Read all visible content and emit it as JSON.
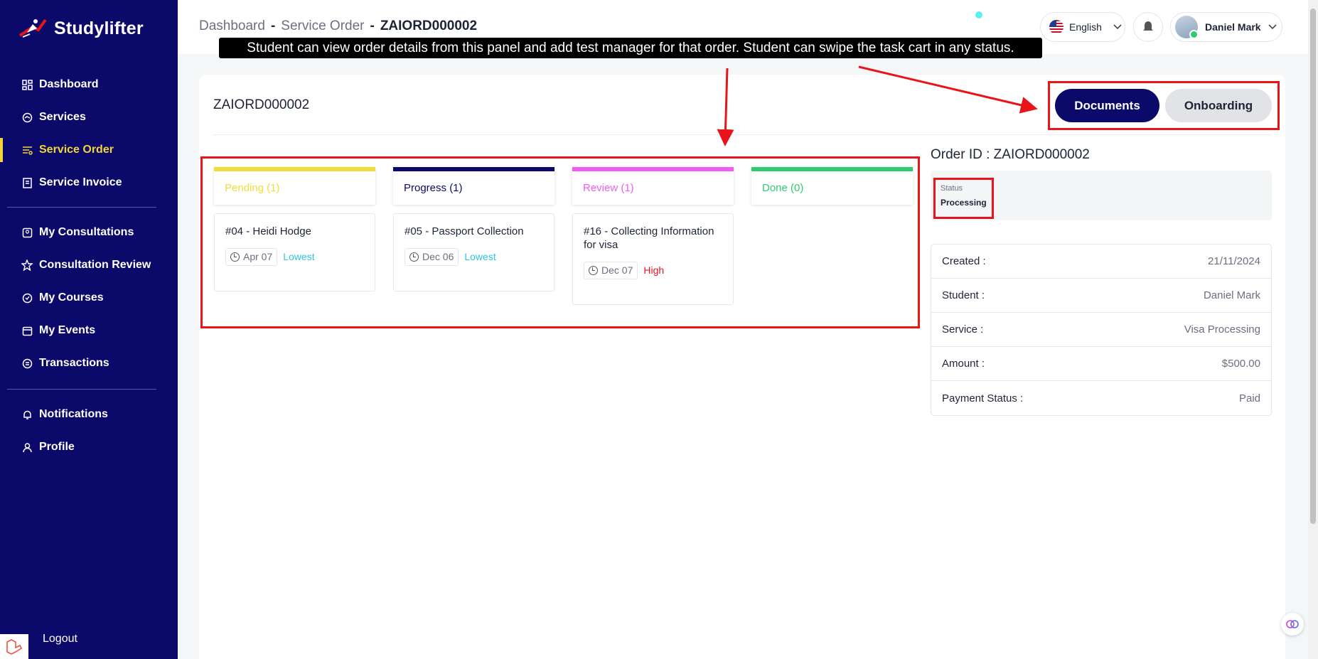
{
  "brand": {
    "name": "Studylifter"
  },
  "sidebar": {
    "group1": [
      {
        "label": "Dashboard",
        "icon": "dashboard-icon",
        "active": false
      },
      {
        "label": "Services",
        "icon": "services-icon",
        "active": false
      },
      {
        "label": "Service Order",
        "icon": "service-order-icon",
        "active": true
      },
      {
        "label": "Service Invoice",
        "icon": "invoice-icon",
        "active": false
      }
    ],
    "group2": [
      {
        "label": "My Consultations",
        "icon": "consultations-icon"
      },
      {
        "label": "Consultation Review",
        "icon": "star-icon"
      },
      {
        "label": "My Courses",
        "icon": "courses-icon"
      },
      {
        "label": "My Events",
        "icon": "calendar-icon"
      },
      {
        "label": "Transactions",
        "icon": "transactions-icon"
      }
    ],
    "group3": [
      {
        "label": "Notifications",
        "icon": "bell-icon"
      },
      {
        "label": "Profile",
        "icon": "user-icon"
      }
    ],
    "logout": "Logout",
    "active_color": "#f4d43c",
    "bg_color": "#0b0a6b"
  },
  "header": {
    "breadcrumb": [
      "Dashboard",
      "Service Order",
      "ZAIORD000002"
    ],
    "separator": "-",
    "language": "English",
    "user_name": "Daniel Mark"
  },
  "banner": {
    "text": "Student can view order details from this panel and add test manager for that order. Student can swipe the task cart in any status."
  },
  "order": {
    "title": "ZAIORD000002",
    "buttons": {
      "documents": "Documents",
      "onboarding": "Onboarding"
    }
  },
  "kanban": {
    "columns": [
      {
        "label": "Pending (1)",
        "color": "#f0dc3c"
      },
      {
        "label": "Progress (1)",
        "color": "#0b0a6b"
      },
      {
        "label": "Review (1)",
        "color": "#f05cf5"
      },
      {
        "label": "Done (0)",
        "color": "#2ecc71"
      }
    ],
    "tasks": [
      {
        "title": "#04 - Heidi Hodge",
        "date": "Apr 07",
        "priority": "Lowest",
        "priority_color": "#2ec5e0"
      },
      {
        "title": "#05 - Passport Collection",
        "date": "Dec 06",
        "priority": "Lowest",
        "priority_color": "#2ec5e0"
      },
      {
        "title": "#16 - Collecting Information for visa",
        "date": "Dec 07",
        "priority": "High",
        "priority_color": "#e8141a"
      }
    ]
  },
  "details": {
    "order_id_label": "Order ID : ZAIORD000002",
    "status_label": "Status",
    "status_value": "Processing",
    "rows": [
      {
        "key": "Created :",
        "value": "21/11/2024"
      },
      {
        "key": "Student :",
        "value": "Daniel Mark"
      },
      {
        "key": "Service :",
        "value": "Visa Processing"
      },
      {
        "key": "Amount :",
        "value": "$500.00"
      },
      {
        "key": "Payment Status :",
        "value": "Paid"
      }
    ]
  }
}
